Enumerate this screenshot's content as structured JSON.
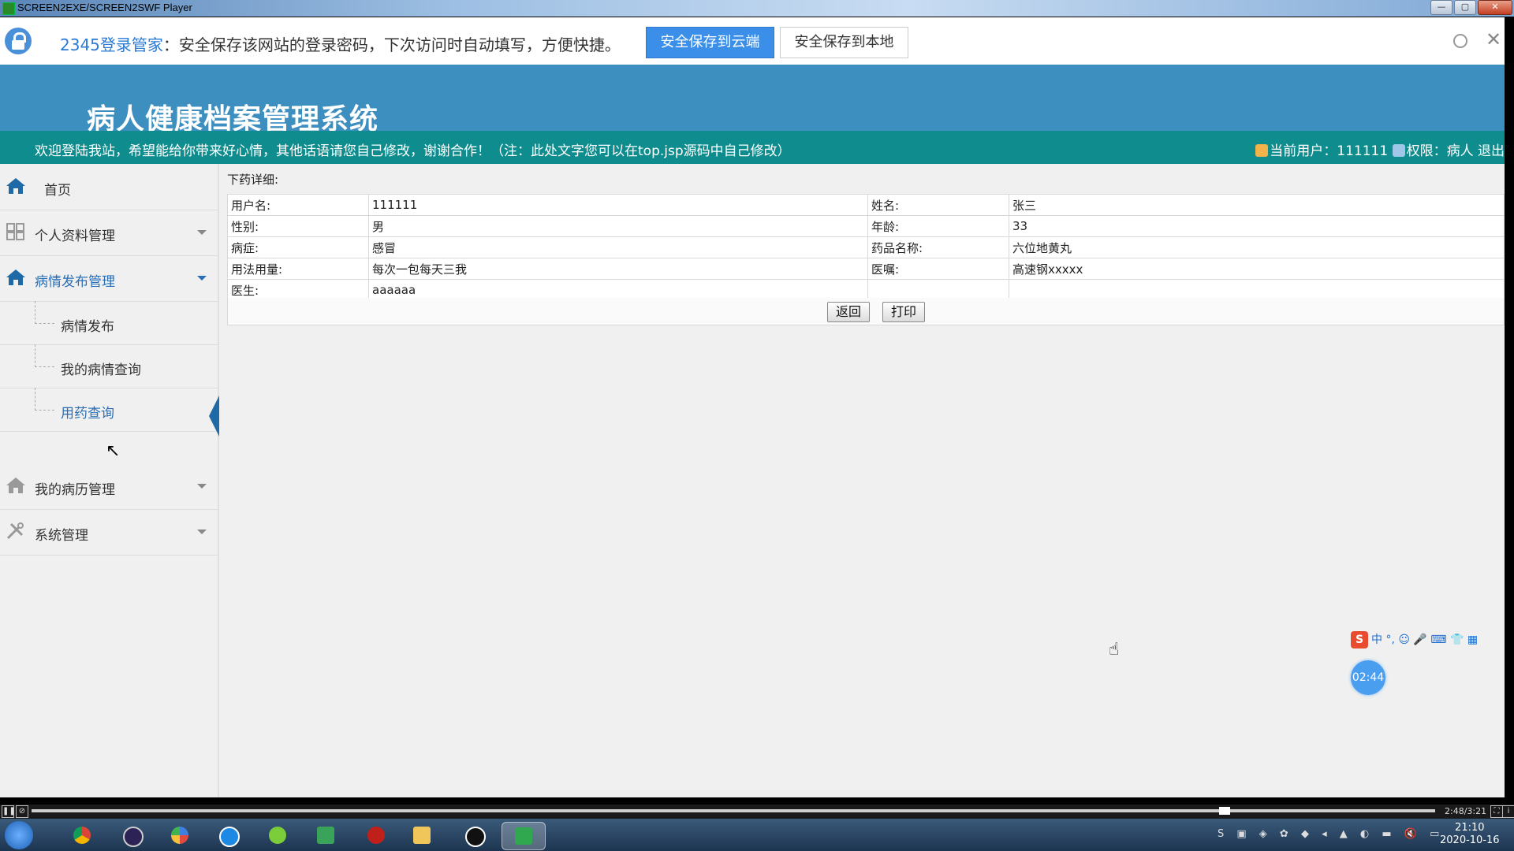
{
  "window": {
    "title": "SCREEN2EXE/SCREEN2SWF Player"
  },
  "password_bar": {
    "brand": "2345登录管家",
    "message": "：安全保存该网站的登录密码，下次访问时自动填写，方便快捷。",
    "save_cloud": "安全保存到云端",
    "save_local": "安全保存到本地",
    "close": "✕"
  },
  "header": {
    "title": "病人健康档案管理系统",
    "welcome": "欢迎登陆我站，希望能给你带来好心情，其他话语请您自己修改，谢谢合作！（注：此处文字您可以在top.jsp源码中自己修改）",
    "current_user_label": "当前用户：",
    "current_user": "111111",
    "role_label": "权限：",
    "role": "病人",
    "logout": "退出"
  },
  "sidebar": {
    "home": "首页",
    "menus": [
      {
        "label": "个人资料管理"
      },
      {
        "label": "病情发布管理"
      },
      {
        "label": "我的病历管理"
      },
      {
        "label": "系统管理"
      }
    ],
    "submenu": [
      {
        "label": "病情发布"
      },
      {
        "label": "我的病情查询"
      },
      {
        "label": "用药查询"
      }
    ]
  },
  "content": {
    "breadcrumb": "下药详细:",
    "fields": {
      "username_label": "用户名:",
      "username": "111111",
      "name_label": "姓名:",
      "name": "张三",
      "gender_label": "性别:",
      "gender": "男",
      "age_label": "年龄:",
      "age": "33",
      "disease_label": "病症:",
      "disease": "感冒",
      "drug_label": "药品名称:",
      "drug": "六位地黄丸",
      "usage_label": "用法用量:",
      "usage": "每次一包每天三我",
      "advice_label": "医嘱:",
      "advice": "高速钢xxxxx",
      "doctor_label": "医生:",
      "doctor": "aaaaaa"
    },
    "back_button": "返回",
    "print_button": "打印"
  },
  "ime": {
    "label": "中",
    "punct": "°,",
    "extra": "☺ 🎤 ⌨ 👕 ▦"
  },
  "timer": "02:44",
  "player": {
    "time": "2:48/3:21",
    "progress": 0.85
  },
  "taskbar": {
    "time": "21:10",
    "date": "2020-10-16"
  },
  "colors": {
    "header": "#3d8fc0",
    "welcome_bar": "#0f8d8e",
    "accent": "#3c8fe8"
  }
}
